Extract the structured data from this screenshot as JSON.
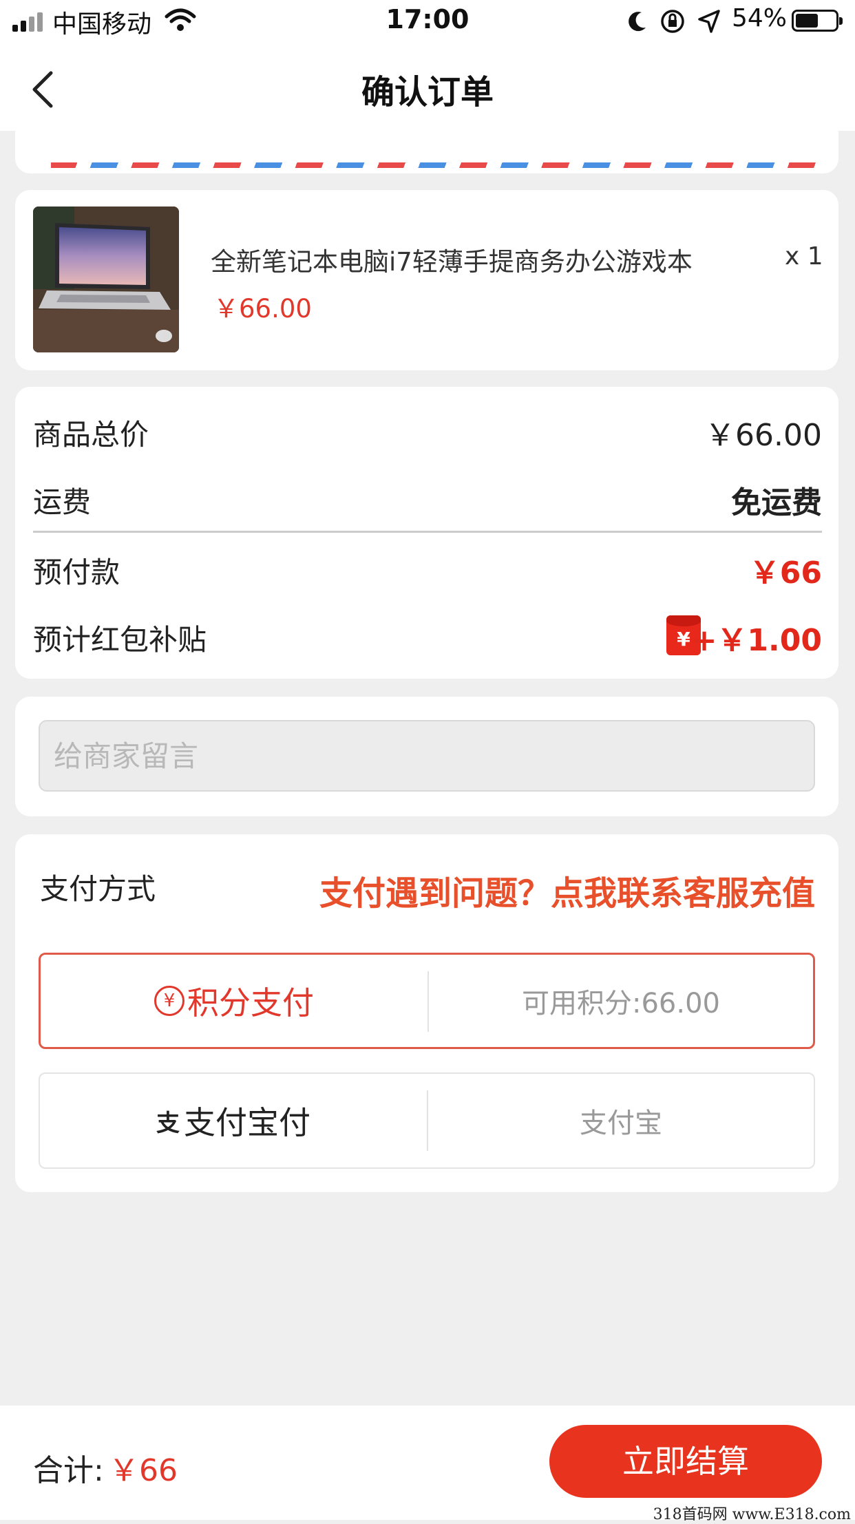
{
  "status_bar": {
    "carrier": "中国移动",
    "time": "17:00",
    "battery": "54%"
  },
  "nav": {
    "title": "确认订单"
  },
  "product": {
    "name": "全新笔记本电脑i7轻薄手提商务办公游戏本",
    "price": "￥66.00",
    "qty": "x 1"
  },
  "summary": {
    "goods_total_label": "商品总价",
    "goods_total_value": "￥66.00",
    "shipping_label": "运费",
    "shipping_value": "免运费",
    "prepay_label": "预付款",
    "prepay_value": "￥66",
    "subsidy_label": "预计红包补贴",
    "subsidy_value": "+￥1.00"
  },
  "message": {
    "placeholder": "给商家留言"
  },
  "payment": {
    "title": "支付方式",
    "help": "支付遇到问题？点我联系客服充值",
    "options": [
      {
        "label": "积分支付",
        "detail": "可用积分:66.00"
      },
      {
        "label": "支付宝付",
        "detail": "支付宝"
      }
    ]
  },
  "footer": {
    "total_label": "合计:",
    "total_value": "￥66",
    "checkout": "立即结算"
  },
  "watermark": "318首码网 www.E318.com",
  "colors": {
    "accent": "#e2372b",
    "help_text": "#e8502b",
    "checkout_button": "#e8341f",
    "background": "#efefef"
  },
  "icons": {
    "back": "chevron-left-icon",
    "points": "yuan-coin-icon",
    "alipay": "alipay-icon",
    "red_packet": "red-packet-icon"
  }
}
